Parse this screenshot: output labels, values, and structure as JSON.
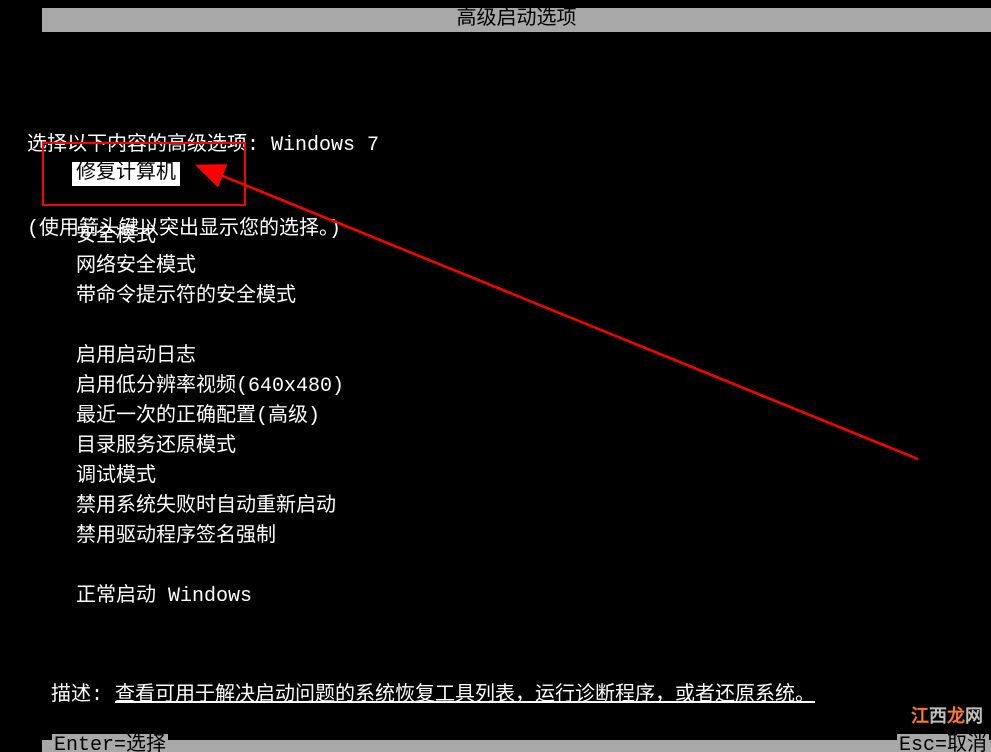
{
  "title": "高级启动选项",
  "prompt": {
    "line1": "选择以下内容的高级选项: Windows 7",
    "line2": "(使用箭头键以突出显示您的选择。)"
  },
  "selected": "修复计算机",
  "menu": {
    "group1": [
      "安全模式",
      "网络安全模式",
      "带命令提示符的安全模式"
    ],
    "group2": [
      "启用启动日志",
      "启用低分辨率视频(640x480)",
      "最近一次的正确配置(高级)",
      "目录服务还原模式",
      "调试模式",
      "禁用系统失败时自动重新启动",
      "禁用驱动程序签名强制"
    ],
    "group3": [
      "正常启动 Windows"
    ]
  },
  "description": {
    "label": "描述:",
    "text": "查看可用于解决启动问题的系统恢复工具列表，运行诊断程序，或者还原系统。"
  },
  "footer": {
    "enter": "Enter=选择",
    "esc": "Esc=取消"
  },
  "watermark": "江西龙网"
}
